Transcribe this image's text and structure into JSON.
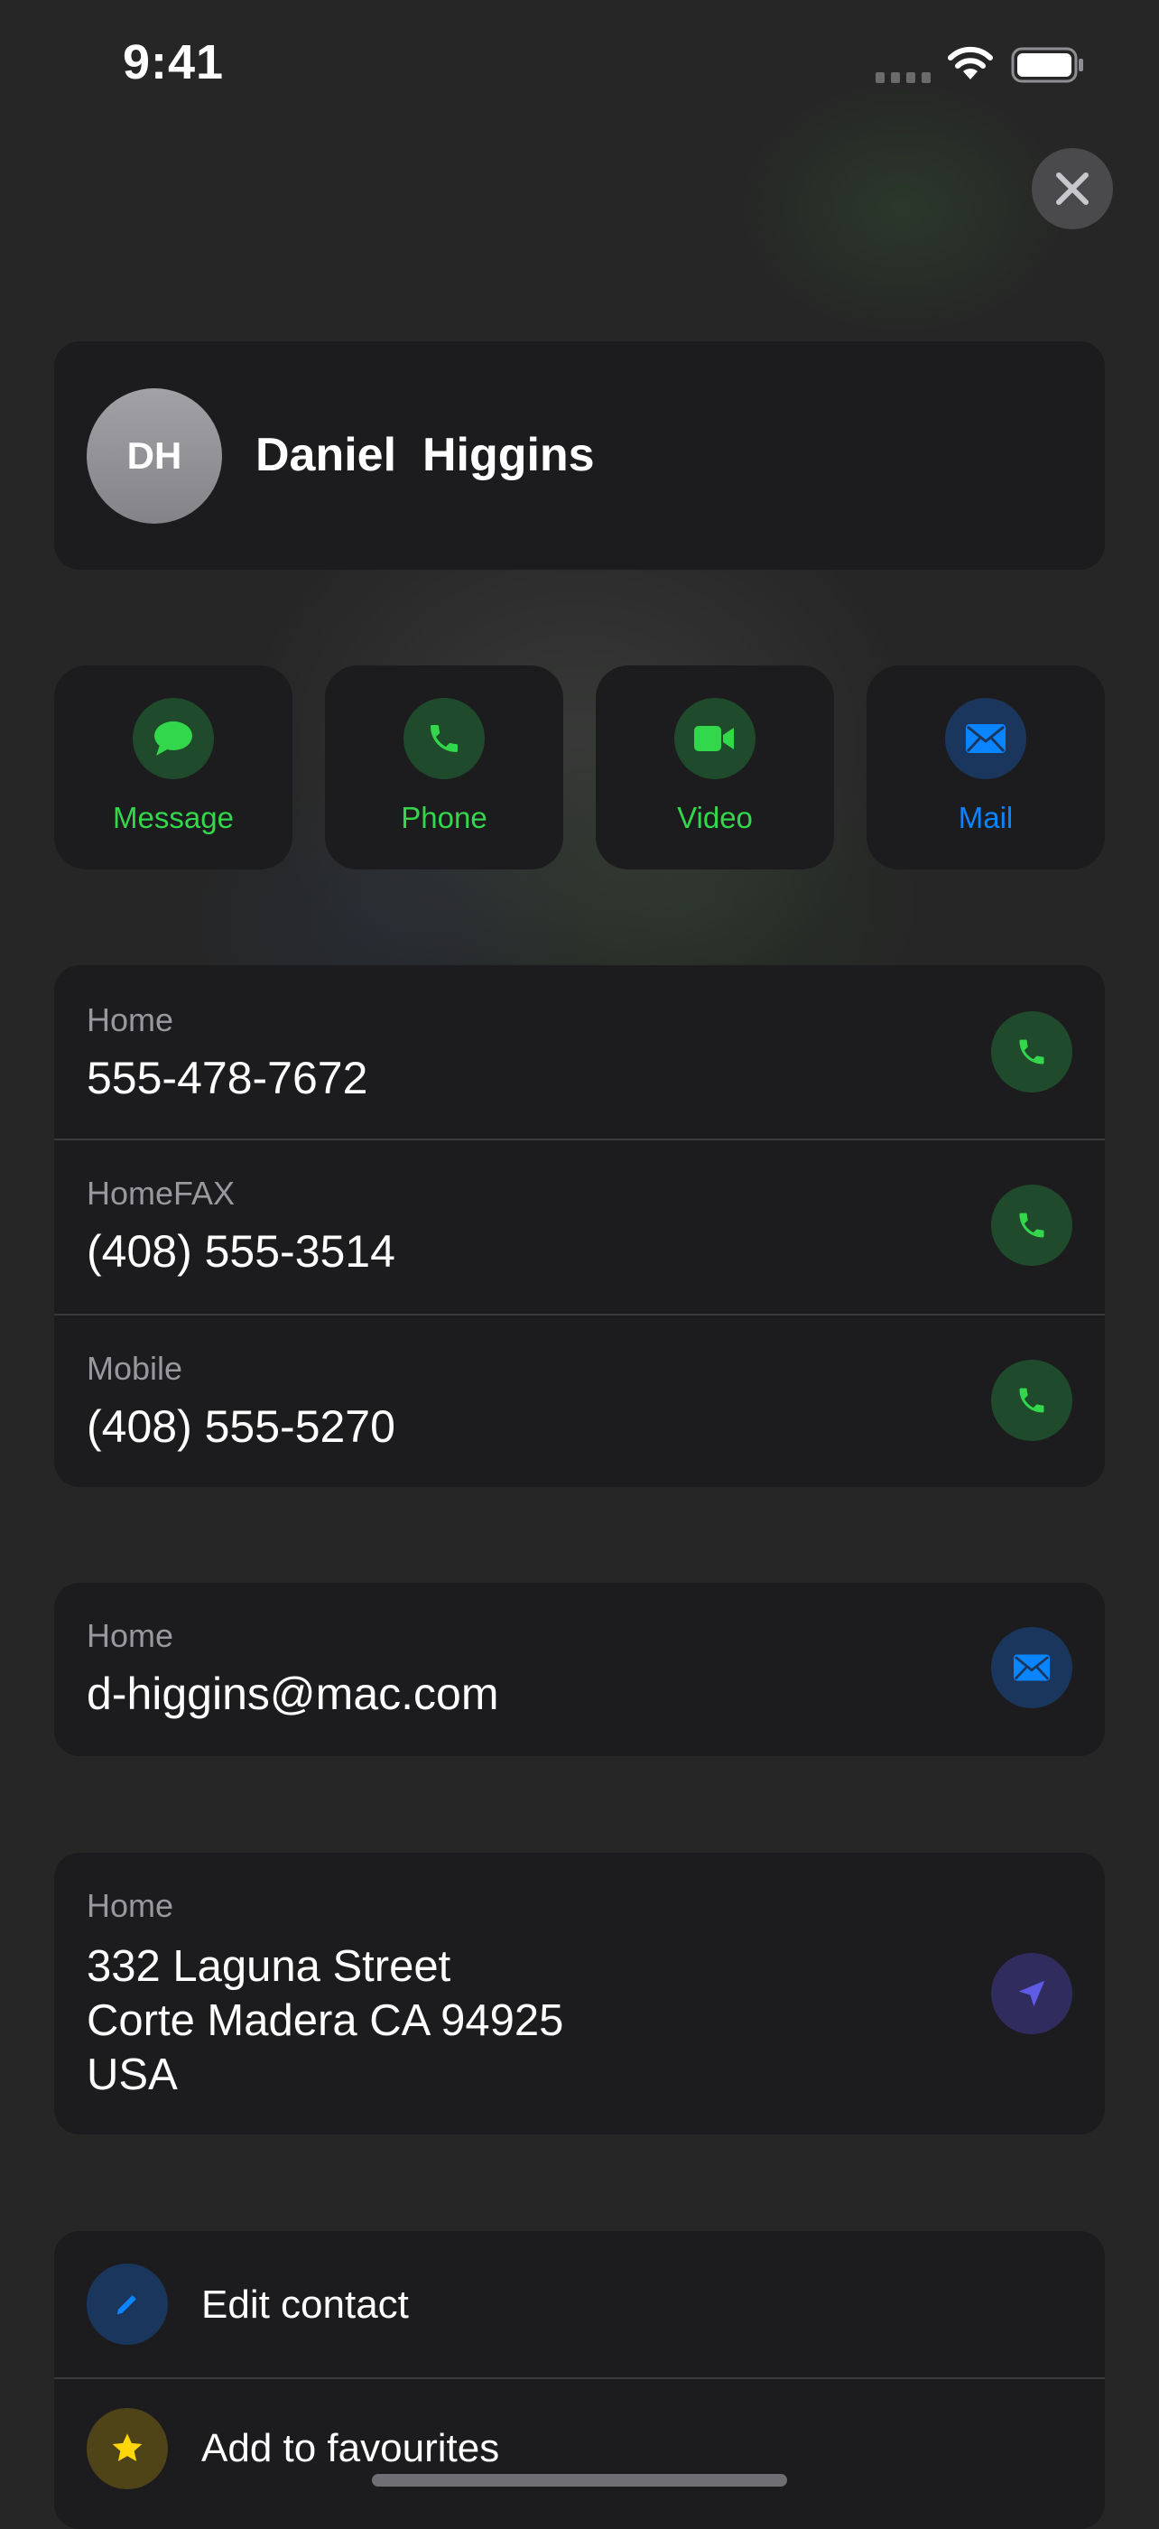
{
  "status_bar": {
    "time": "9:41"
  },
  "contact": {
    "initials": "DH",
    "name": "Daniel  Higgins"
  },
  "actions": [
    {
      "label": "Message",
      "icon": "message-bubble-icon",
      "color": "#32d74b"
    },
    {
      "label": "Phone",
      "icon": "phone-icon",
      "color": "#32d74b"
    },
    {
      "label": "Video",
      "icon": "video-camera-icon",
      "color": "#32d74b"
    },
    {
      "label": "Mail",
      "icon": "envelope-icon",
      "color": "#0a84ff"
    }
  ],
  "phones": [
    {
      "label": "Home",
      "value": "555-478-7672"
    },
    {
      "label": "HomeFAX",
      "value": "(408) 555-3514"
    },
    {
      "label": "Mobile",
      "value": "(408) 555-5270"
    }
  ],
  "email": {
    "label": "Home",
    "value": "d-higgins@mac.com"
  },
  "address": {
    "label": "Home",
    "lines": [
      "332 Laguna Street",
      "Corte Madera CA 94925",
      "USA"
    ]
  },
  "menu": [
    {
      "label": "Edit contact",
      "icon": "pencil-icon",
      "color": "#0a84ff"
    },
    {
      "label": "Add to favourites",
      "icon": "star-icon",
      "color": "#ffd60a"
    }
  ],
  "colors": {
    "background": "#262626",
    "card": "#1c1c1e",
    "accent_green": "#32d74b",
    "accent_blue": "#0a84ff",
    "accent_purple": "#5e5ce6",
    "accent_yellow": "#ffd60a",
    "secondary_text": "#98989d"
  }
}
